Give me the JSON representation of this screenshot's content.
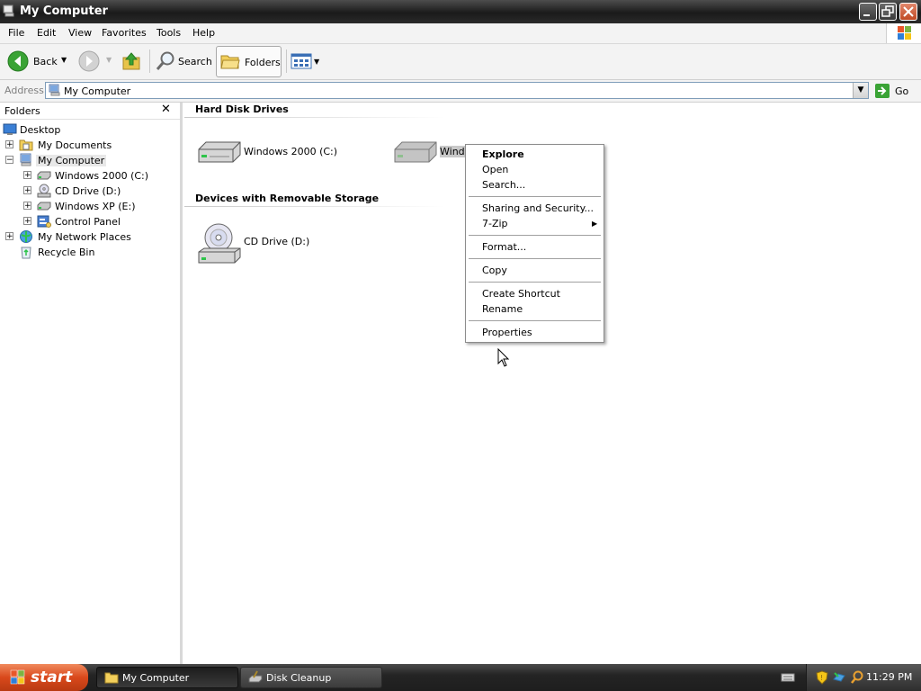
{
  "window": {
    "title": "My Computer"
  },
  "menu": [
    "File",
    "Edit",
    "View",
    "Favorites",
    "Tools",
    "Help"
  ],
  "toolbar": {
    "back_label": "Back",
    "search_label": "Search",
    "folders_label": "Folders"
  },
  "address": {
    "label": "Address",
    "value": "My Computer",
    "go_label": "Go"
  },
  "folders_pane": {
    "title": "Folders",
    "close_glyph": "✕",
    "items": [
      {
        "label": "Desktop",
        "expander": ""
      },
      {
        "label": "My Documents",
        "expander": "+"
      },
      {
        "label": "My Computer",
        "expander": "−",
        "selected": true
      },
      {
        "label": "Windows 2000 (C:)",
        "expander": "+"
      },
      {
        "label": "CD Drive (D:)",
        "expander": "+"
      },
      {
        "label": "Windows XP (E:)",
        "expander": "+"
      },
      {
        "label": "Control Panel",
        "expander": "+"
      },
      {
        "label": "My Network Places",
        "expander": "+"
      },
      {
        "label": "Recycle Bin",
        "expander": ""
      }
    ]
  },
  "content": {
    "groups": [
      {
        "title": "Hard Disk Drives",
        "items": [
          {
            "label": "Windows 2000 (C:)"
          },
          {
            "label": "Windo"
          }
        ]
      },
      {
        "title": "Devices with Removable Storage",
        "items": [
          {
            "label": "CD Drive (D:)"
          }
        ]
      }
    ]
  },
  "context_menu": {
    "items": [
      "Explore",
      "Open",
      "Search...",
      "Sharing and Security...",
      "7-Zip",
      "Format...",
      "Copy",
      "Create Shortcut",
      "Rename",
      "Properties"
    ],
    "submenu_arrow": "▶"
  },
  "taskbar": {
    "start_label": "start",
    "tasks": [
      "My Computer",
      "Disk Cleanup"
    ],
    "clock": "11:29 PM"
  }
}
